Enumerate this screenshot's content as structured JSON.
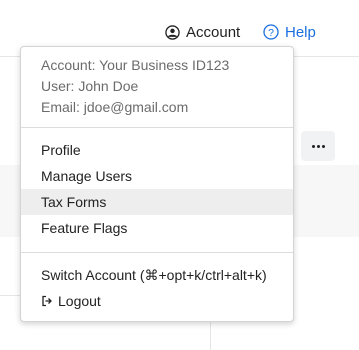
{
  "topbar": {
    "account_label": "Account",
    "help_label": "Help"
  },
  "menu": {
    "account_line": "Account: Your Business ID123",
    "user_line": "User: John Doe",
    "email_line": "Email: jdoe@gmail.com",
    "items": [
      {
        "label": "Profile"
      },
      {
        "label": "Manage Users"
      },
      {
        "label": "Tax Forms",
        "highlighted": true
      },
      {
        "label": "Feature Flags"
      }
    ],
    "switch_account_label": "Switch Account (⌘+opt+k/ctrl+alt+k)",
    "logout_label": "Logout"
  },
  "colors": {
    "help_accent": "#1a6fe0",
    "highlight_bg": "#eeeeee",
    "info_text": "#6b6b6b"
  },
  "icons": {
    "account": "user-circle-icon",
    "help": "question-circle-icon",
    "more": "ellipsis-icon",
    "logout": "logout-icon"
  }
}
